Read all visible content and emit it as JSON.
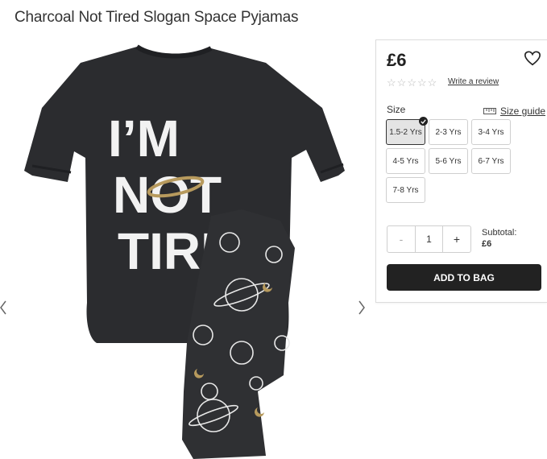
{
  "product": {
    "title": "Charcoal Not Tired Slogan Space Pyjamas",
    "shirt_text": {
      "line1": "I’M",
      "line2": "NOT",
      "line3": "TIRE"
    }
  },
  "gallery": {
    "prev_icon": "chevron-left-icon",
    "next_icon": "chevron-right-icon"
  },
  "buy_panel": {
    "price": "£6",
    "wishlist_icon": "heart-icon",
    "rating": 0,
    "write_review_label": "Write a review",
    "size_label": "Size",
    "size_guide_label": "Size guide",
    "size_guide_icon": "ruler-icon",
    "sizes": [
      "1.5-2 Yrs",
      "2-3 Yrs",
      "3-4 Yrs",
      "4-5 Yrs",
      "5-6 Yrs",
      "6-7 Yrs",
      "7-8 Yrs"
    ],
    "selected_size": "1.5-2 Yrs",
    "quantity": {
      "minus_label": "-",
      "value": "1",
      "plus_label": "+"
    },
    "subtotal_label": "Subtotal:",
    "subtotal_value": "£6",
    "add_to_bag_label": "ADD TO BAG"
  },
  "colors": {
    "garment": "#2b2c2f",
    "button": "#222222",
    "selected_size_bg": "#e4e4e4"
  }
}
